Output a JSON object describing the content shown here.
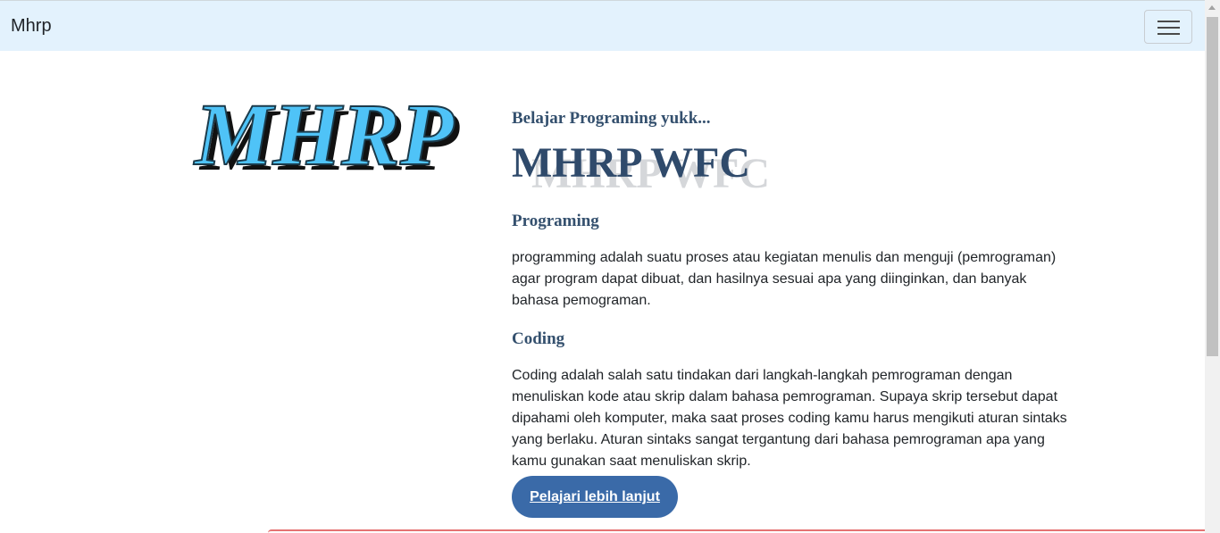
{
  "navbar": {
    "brand": "Mhrp",
    "toggler_icon": "hamburger-menu-icon"
  },
  "logo": {
    "text": "MHRP",
    "fill": "#4fc3f7",
    "shadow": "#1a1a1a"
  },
  "hero": {
    "tagline": "Belajar Programing yukk...",
    "title": "MHRP WFC",
    "title_shadow": "MHRP WFC"
  },
  "sections": [
    {
      "heading": "Programing",
      "lines": [
        "programming adalah suatu proses atau kegiatan menulis dan menguji (pemrograman)",
        "agar program dapat dibuat, dan hasilnya sesuai apa yang diinginkan, dan banyak",
        "bahasa pemograman."
      ]
    },
    {
      "heading": "Coding",
      "lines": [
        "Coding adalah salah satu tindakan dari langkah-langkah pemrograman dengan",
        "menuliskan kode atau skrip dalam bahasa pemrograman. Supaya skrip tersebut dapat",
        "dipahami oleh komputer, maka saat proses coding kamu harus mengikuti aturan sintaks",
        "yang berlaku. Aturan sintaks sangat tergantung dari bahasa pemrograman apa yang",
        "kamu gunakan saat menuliskan skrip."
      ]
    }
  ],
  "cta": {
    "label": "Pelajari lebih lanjut"
  },
  "colors": {
    "navbar_bg": "#e3f2fd",
    "heading": "#34506e",
    "button": "#3a6aa8",
    "accent_line": "#e57373"
  }
}
